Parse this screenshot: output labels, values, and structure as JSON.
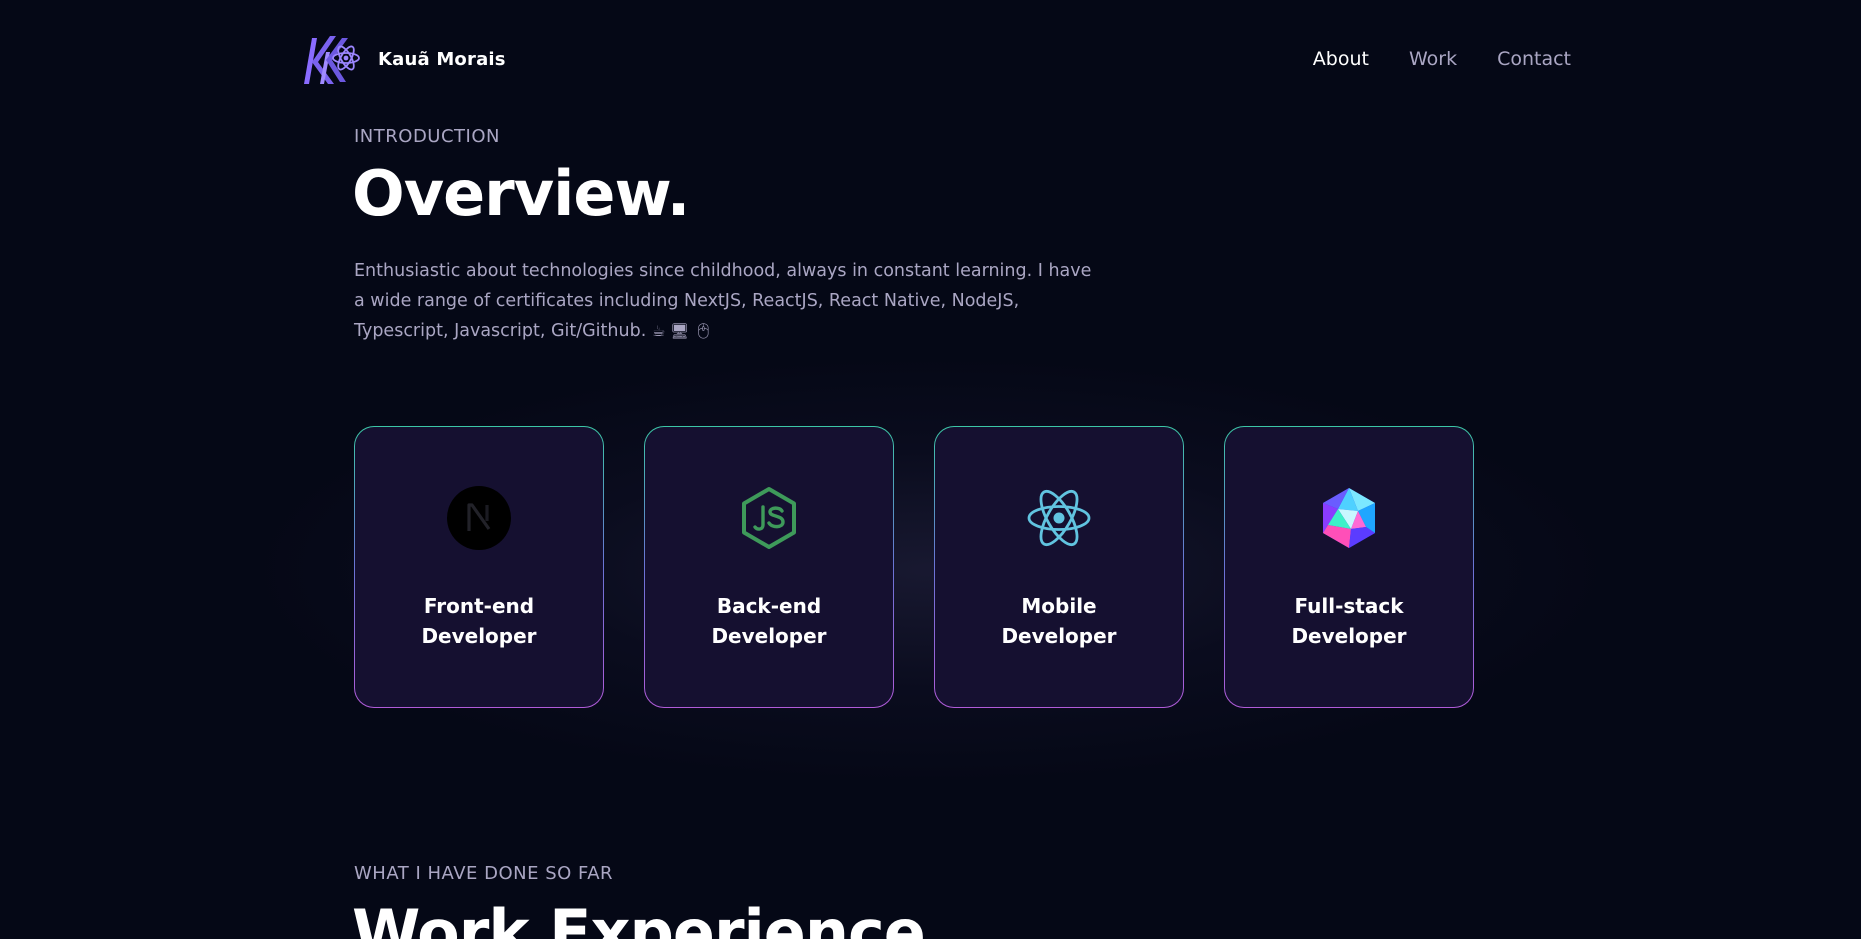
{
  "brand": {
    "name": "Kauã Morais",
    "logo_icon": "kk-react-atom-logo"
  },
  "nav": {
    "items": [
      {
        "label": "About",
        "active": true
      },
      {
        "label": "Work",
        "active": false
      },
      {
        "label": "Contact",
        "active": false
      }
    ]
  },
  "overview": {
    "subtitle": "Introduction",
    "heading": "Overview.",
    "text": "Enthusiastic about technologies since childhood, always in constant learning. I have a wide range of certificates including NextJS, ReactJS, React Native, NodeJS, Typescript, Javascript, Git/Github.",
    "emojis": "☕ 🖥 🖱"
  },
  "services": [
    {
      "title": "Front-end Developer",
      "icon": "nextjs-icon"
    },
    {
      "title": "Back-end Developer",
      "icon": "nodejs-icon"
    },
    {
      "title": "Mobile Developer",
      "icon": "react-icon"
    },
    {
      "title": "Full-stack Developer",
      "icon": "crystal-icosahedron-icon"
    }
  ],
  "experience": {
    "subtitle": "What I have done so far",
    "heading": "Work Experience."
  },
  "colors": {
    "background": "#050816",
    "card": "#151030",
    "secondary_text": "#aaa6c3",
    "card_border_top": "#3cc7a6",
    "card_border_bottom": "#b15bd9",
    "logo": "#915eff"
  }
}
